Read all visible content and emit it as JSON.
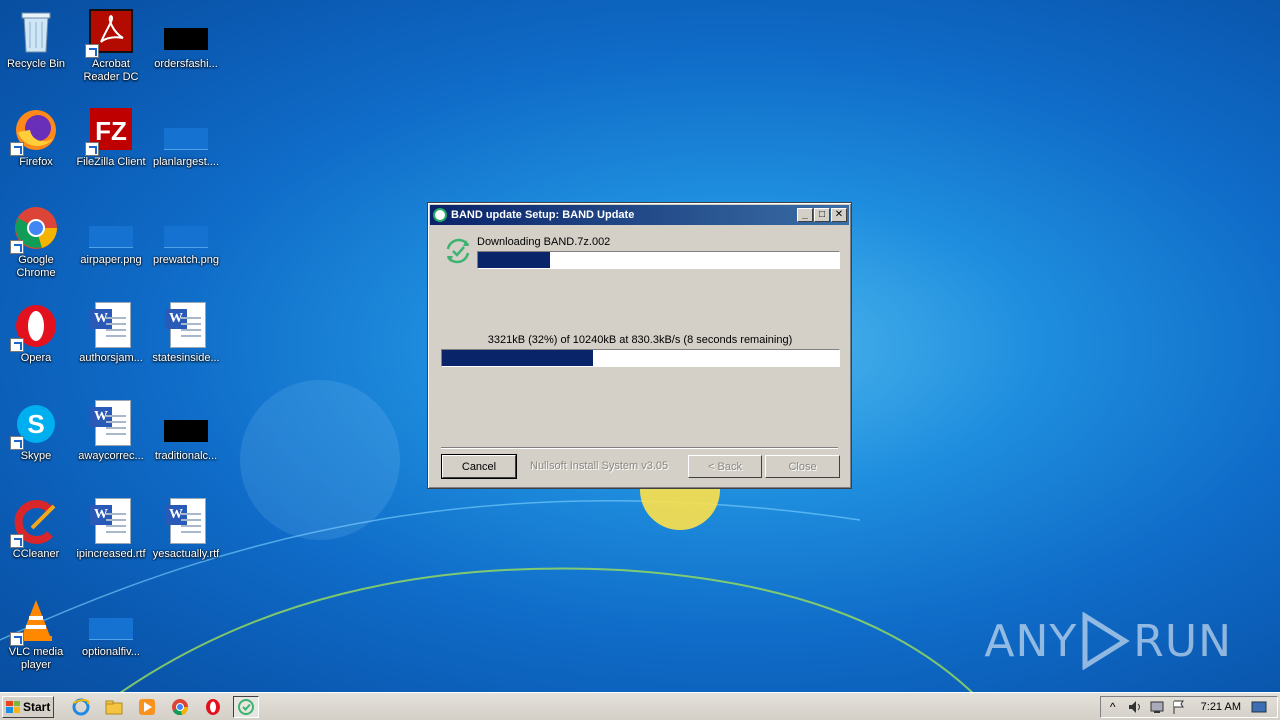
{
  "desktop": {
    "icons": [
      {
        "label": "Recycle Bin",
        "icon": "recycle-bin-icon"
      },
      {
        "label": "Acrobat Reader DC",
        "icon": "acrobat-icon"
      },
      {
        "label": "ordersfashi...",
        "icon": "file-icon"
      },
      {
        "label": "Firefox",
        "icon": "firefox-icon"
      },
      {
        "label": "FileZilla Client",
        "icon": "filezilla-icon"
      },
      {
        "label": "planlargest....",
        "icon": "file-icon"
      },
      {
        "label": "Google Chrome",
        "icon": "chrome-icon"
      },
      {
        "label": "airpaper.png",
        "icon": "image-file-icon"
      },
      {
        "label": "prewatch.png",
        "icon": "image-file-icon"
      },
      {
        "label": "Opera",
        "icon": "opera-icon"
      },
      {
        "label": "authorsjam...",
        "icon": "word-doc-icon"
      },
      {
        "label": "statesinside...",
        "icon": "word-doc-icon"
      },
      {
        "label": "Skype",
        "icon": "skype-icon"
      },
      {
        "label": "awaycorrec...",
        "icon": "word-doc-icon"
      },
      {
        "label": "traditionalc...",
        "icon": "file-icon"
      },
      {
        "label": "CCleaner",
        "icon": "ccleaner-icon"
      },
      {
        "label": "ipincreased.rtf",
        "icon": "word-doc-icon"
      },
      {
        "label": "yesactually.rtf",
        "icon": "word-doc-icon"
      },
      {
        "label": "VLC media player",
        "icon": "vlc-icon"
      },
      {
        "label": "optionalfiv...",
        "icon": "file-icon"
      }
    ]
  },
  "dialog": {
    "title": "BAND update Setup: BAND Update",
    "status": "Downloading BAND.7z.002",
    "status_progress": 0.2,
    "progress_text": "3321kB (32%) of 10240kB at 830.3kB/s (8 seconds remaining)",
    "download_progress": 0.38,
    "cancel_label": "Cancel",
    "branding": "Nullsoft Install System v3.05",
    "back_label": "< Back",
    "close_label": "Close",
    "window_buttons": {
      "minimize": "_",
      "maximize": "□",
      "close": "✕"
    }
  },
  "watermark": {
    "left": "ANY",
    "right": "RUN"
  },
  "taskbar": {
    "start_label": "Start",
    "pinned": [
      "ie-icon",
      "explorer-icon",
      "media-player-icon",
      "chrome-icon",
      "opera-icon",
      "band-setup-icon"
    ],
    "clock": "7:21 AM"
  }
}
